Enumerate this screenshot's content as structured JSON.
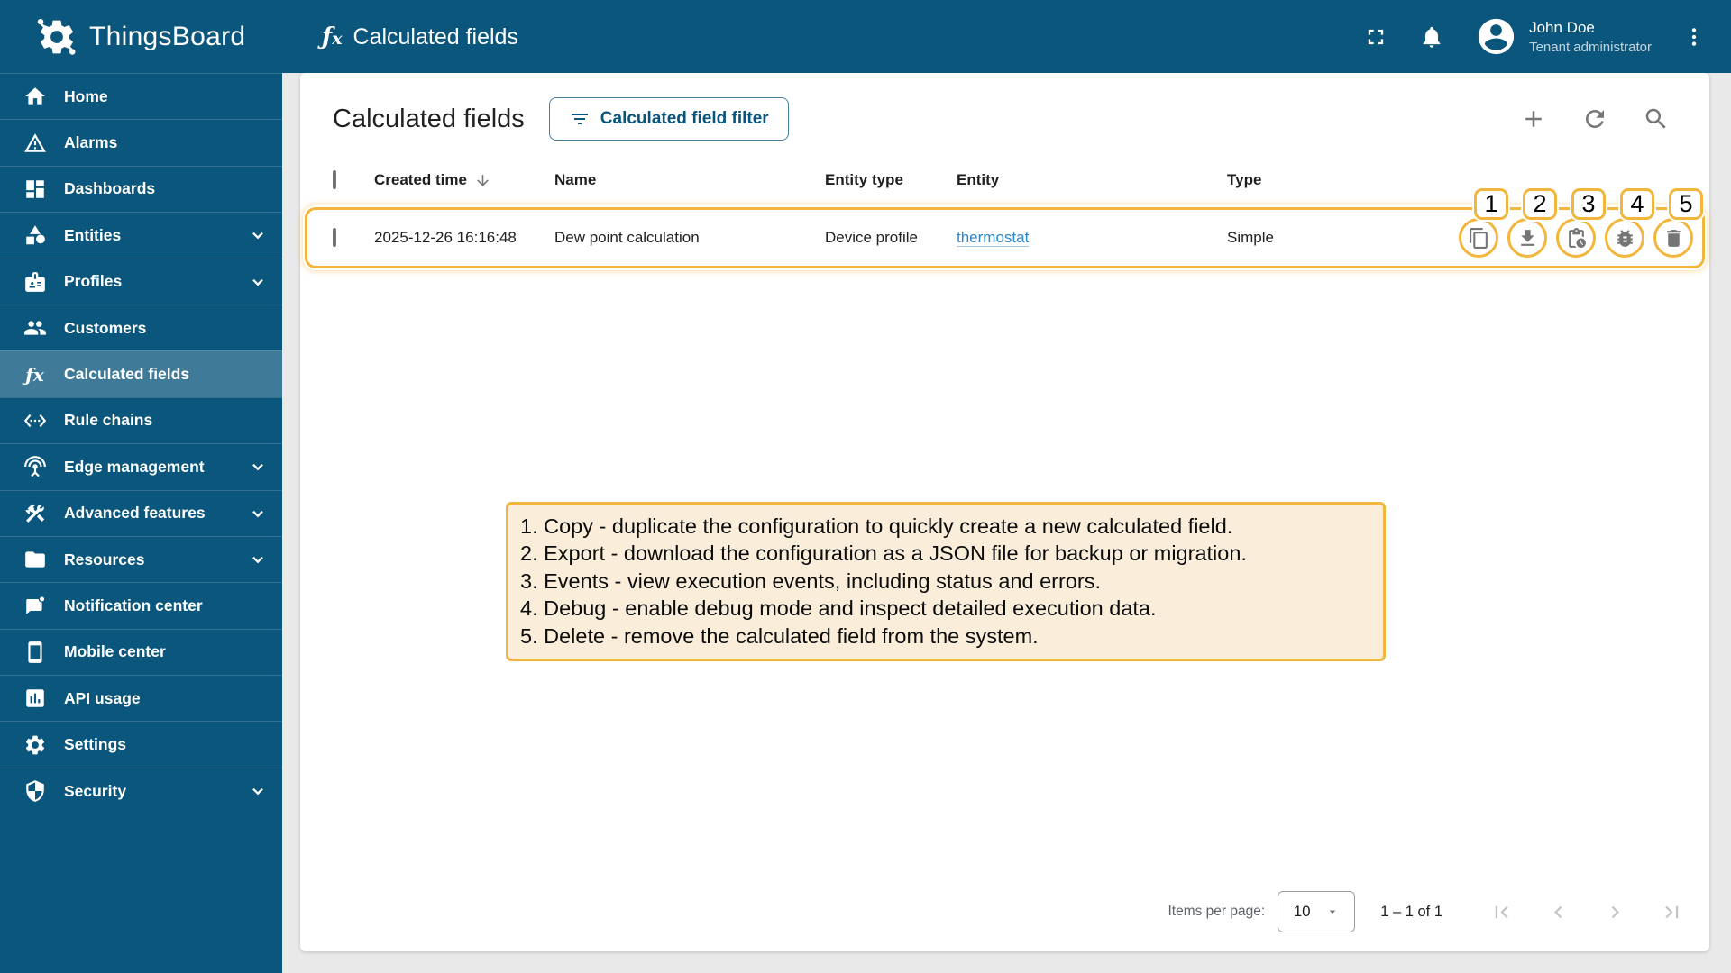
{
  "brand": {
    "name": "ThingsBoard"
  },
  "header": {
    "page_title": "Calculated fields",
    "fx_symbol": "ƒ",
    "fx_sub": "x",
    "user": {
      "name": "John Doe",
      "role": "Tenant administrator"
    }
  },
  "sidebar": {
    "items": [
      {
        "label": "Home",
        "icon": "home-icon"
      },
      {
        "label": "Alarms",
        "icon": "warning-icon"
      },
      {
        "label": "Dashboards",
        "icon": "dashboards-icon"
      },
      {
        "label": "Entities",
        "icon": "entities-icon",
        "expandable": true
      },
      {
        "label": "Profiles",
        "icon": "id-badge-icon",
        "expandable": true
      },
      {
        "label": "Customers",
        "icon": "people-icon"
      },
      {
        "label": "Calculated fields",
        "icon": "fx-icon",
        "selected": true
      },
      {
        "label": "Rule chains",
        "icon": "rule-chain-icon"
      },
      {
        "label": "Edge management",
        "icon": "antenna-icon",
        "expandable": true
      },
      {
        "label": "Advanced features",
        "icon": "tools-icon",
        "expandable": true
      },
      {
        "label": "Resources",
        "icon": "folder-icon",
        "expandable": true
      },
      {
        "label": "Notification center",
        "icon": "notification-icon"
      },
      {
        "label": "Mobile center",
        "icon": "phone-icon"
      },
      {
        "label": "API usage",
        "icon": "bar-chart-icon"
      },
      {
        "label": "Settings",
        "icon": "gear-icon"
      },
      {
        "label": "Security",
        "icon": "shield-icon",
        "expandable": true
      }
    ]
  },
  "main": {
    "title": "Calculated fields",
    "filter_button_label": "Calculated field filter",
    "table": {
      "columns": {
        "created_time": "Created time",
        "name": "Name",
        "entity_type": "Entity type",
        "entity": "Entity",
        "type": "Type"
      },
      "row": {
        "created_time": "2025-12-26 16:16:48",
        "name": "Dew point calculation",
        "entity_type": "Device profile",
        "entity": "thermostat",
        "type": "Simple"
      },
      "row_actions": [
        "copy",
        "download",
        "events",
        "debug",
        "delete"
      ]
    },
    "paginator": {
      "label": "Items per page:",
      "page_size": "10",
      "range": "1 – 1 of 1"
    }
  },
  "annotations": {
    "badges": [
      "1",
      "2",
      "3",
      "4",
      "5"
    ],
    "notes": [
      "1. Copy - duplicate the configuration to quickly create a new calculated field.",
      "2. Export -  download the configuration as a JSON file for backup or migration.",
      "3. Events - view execution events, including status and errors.",
      "4. Debug - enable debug mode and inspect detailed execution data.",
      "5. Delete - remove the calculated field from the system."
    ]
  },
  "colors": {
    "primary": "#0a567c",
    "annotation_border": "#f2b63c",
    "annotation_bg": "#faeeda",
    "link": "#2e86c8",
    "icon_gray": "#757575"
  }
}
